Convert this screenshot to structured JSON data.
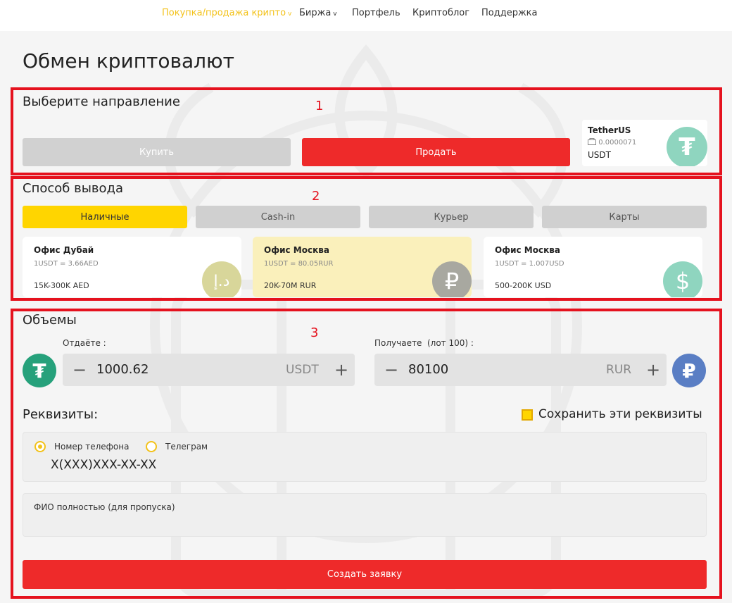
{
  "nav": {
    "items": [
      {
        "label": "Покупка/продажа крипто",
        "has_dropdown": true,
        "active": true
      },
      {
        "label": "Биржа",
        "has_dropdown": true,
        "active": false
      },
      {
        "label": "Портфель",
        "has_dropdown": false,
        "active": false
      },
      {
        "label": "Криптоблог",
        "has_dropdown": false,
        "active": false
      },
      {
        "label": "Поддержка",
        "has_dropdown": false,
        "active": false
      }
    ],
    "dropdown_glyph": "v"
  },
  "page": {
    "title": "Обмен криптовалют"
  },
  "annotations": [
    "1",
    "2",
    "3"
  ],
  "direction": {
    "title": "Выберите направление",
    "buy_label": "Купить",
    "sell_label": "Продать",
    "token": {
      "name": "TetherUS",
      "balance": "0.0000071",
      "symbol": "USDT",
      "icon": "tether-icon",
      "icon_glyph": "₮"
    }
  },
  "withdrawal": {
    "title": "Способ вывода",
    "tabs": [
      "Наличные",
      "Cash-in",
      "Курьер",
      "Карты"
    ],
    "active_tab": 0,
    "offices": [
      {
        "name": "Офис Дубай",
        "rate": "1USDT = 3.66AED",
        "range": "15K-300K AED",
        "icon": "dirham-icon",
        "icon_glyph": "د.إ",
        "icon_color": "#d8d69a",
        "selected": false
      },
      {
        "name": "Офис Москва",
        "rate": "1USDT = 80.05RUR",
        "range": "20K-70M RUR",
        "icon": "ruble-icon",
        "icon_glyph": "₽",
        "icon_color": "#a8a8a0",
        "selected": true
      },
      {
        "name": "Офис Москва",
        "rate": "1USDT = 1.007USD",
        "range": "500-200K USD",
        "icon": "dollar-icon",
        "icon_glyph": "$",
        "icon_color": "#8fd5bf",
        "selected": false
      }
    ]
  },
  "volumes": {
    "title": "Объемы",
    "give": {
      "label": "Отдаёте :",
      "value": "1000.62",
      "currency": "USDT",
      "icon": "tether-icon",
      "icon_glyph": "₮",
      "color": "#26a17b"
    },
    "receive": {
      "label": "Получаете  (лот 100) :",
      "value": "80100",
      "currency": "RUR",
      "icon": "ruble-icon",
      "icon_glyph": "₽",
      "color": "#5a7ec4"
    },
    "minus": "−",
    "plus": "+"
  },
  "requisites": {
    "title": "Реквизиты:",
    "save_label": "Сохранить эти реквизиты",
    "save_checked": true,
    "contact_options": [
      "Номер телефона",
      "Телеграм"
    ],
    "selected_contact": 0,
    "phone_placeholder": "X(XXX)XXX-XX-XX",
    "fio_label": "ФИО полностью (для пропуска)",
    "submit_label": "Создать заявку"
  },
  "colors": {
    "accent_red": "#ee2a2a",
    "accent_yellow": "#ffd500",
    "annotation_red": "#e5121e"
  }
}
